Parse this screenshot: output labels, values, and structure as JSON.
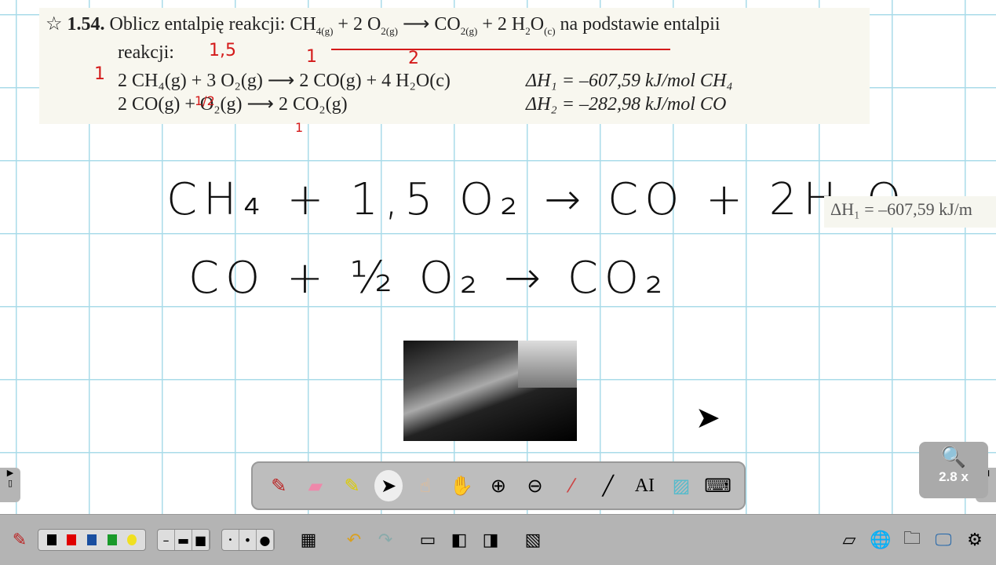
{
  "problem": {
    "line1_num": "1.54.",
    "line1_text": "Oblicz entalpię reakcji: CH",
    "line1_rest": " + 2 O",
    "line1_arrow": " ⟶ CO",
    "line1_tail": " + 2 H",
    "line1_end": "O",
    "line1_suffix": " na podstawie entalpii",
    "line2": "reakcji:",
    "eq1": "2 CH₄(g) + 3 O₂(g) ⟶ 2 CO(g) + 4 H₂O(c)",
    "eq2": "2 CO(g) + O₂(g) ⟶ 2 CO₂(g)",
    "dh1": "ΔH₁ = –607,59 kJ/mol CH₄",
    "dh2": "ΔH₂ = –282,98 kJ/mol CO",
    "annotations": [
      "1",
      "1,5",
      "1",
      "2",
      "1/2",
      "1"
    ]
  },
  "handwriting": {
    "eq1": "CH₄ + 1,5 O₂ → CO + 2H₂O",
    "eq2": "CO + ½ O₂ → CO₂"
  },
  "snippet": "ΔH₁ = –607,59 kJ/m",
  "zoom": {
    "level": "2.8 x"
  },
  "tools": [
    "pen",
    "eraser",
    "highlighter",
    "select",
    "magic-pointer",
    "pan",
    "zoom-in",
    "zoom-out",
    "pick-color",
    "line",
    "text",
    "screen-capture",
    "keyboard"
  ],
  "colors": [
    "#000000",
    "#e00000",
    "#1a4fa0",
    "#1a9a2a",
    "#f0e020"
  ]
}
